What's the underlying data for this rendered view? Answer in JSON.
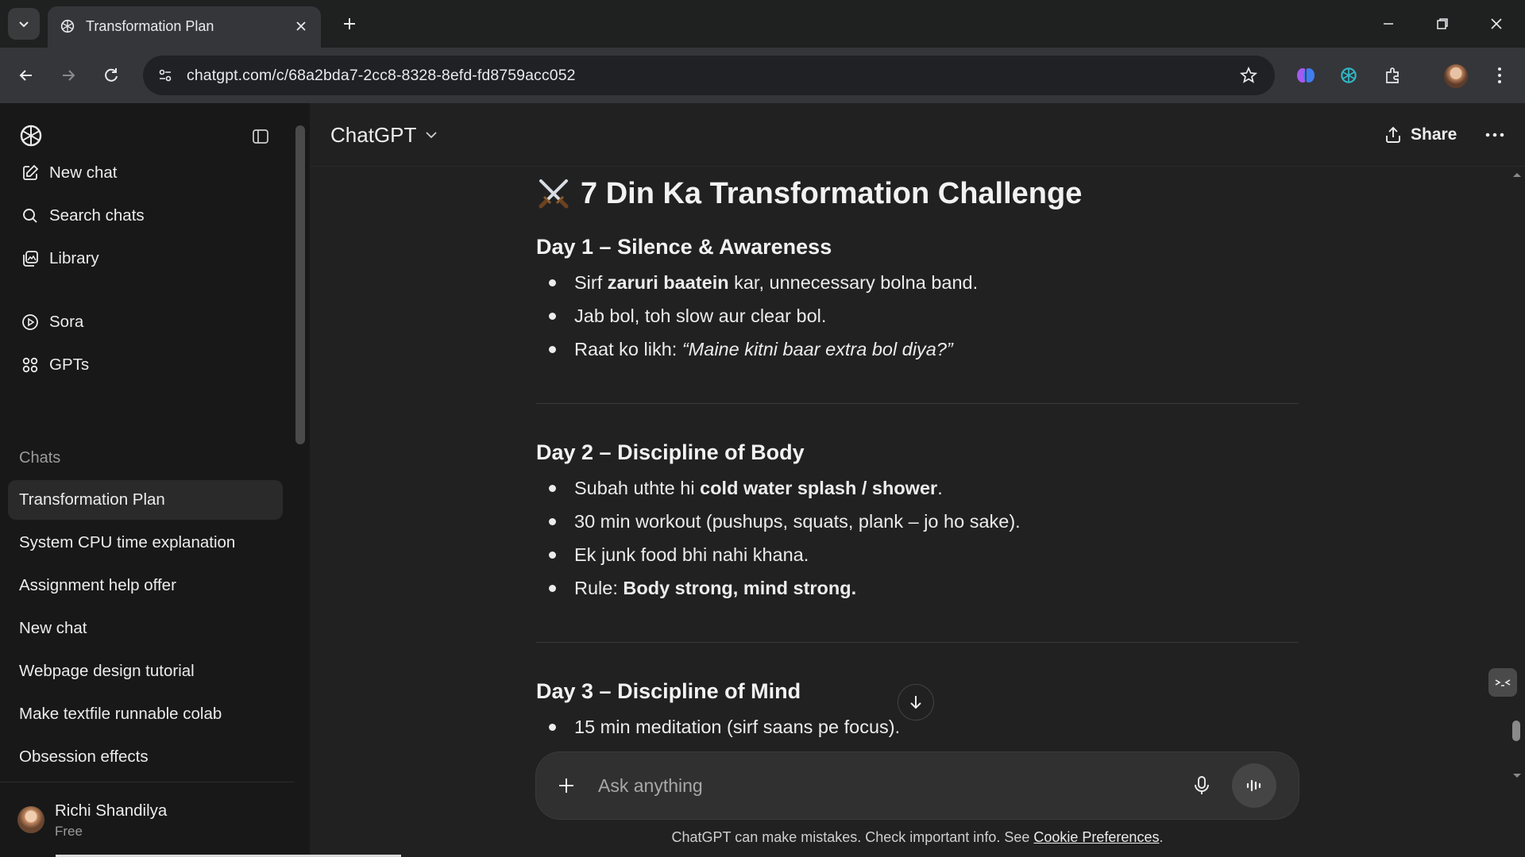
{
  "browser": {
    "tab_title": "Transformation Plan",
    "url": "chatgpt.com/c/68a2bda7-2cc8-8328-8efd-fd8759acc052",
    "icons": [
      "tab-list-icon",
      "openai-favicon",
      "close-icon",
      "plus-icon",
      "minimize-icon",
      "restore-icon",
      "close-window-icon",
      "back-icon",
      "forward-icon",
      "reload-icon",
      "site-info-icon",
      "star-icon",
      "extension-brain-icon",
      "extension-chatgpt-icon",
      "puzzle-icon",
      "more-vert-icon"
    ]
  },
  "sidebar": {
    "nav": [
      {
        "label": "New chat",
        "icon": "edit-icon"
      },
      {
        "label": "Search chats",
        "icon": "search-icon"
      },
      {
        "label": "Library",
        "icon": "library-icon"
      },
      {
        "label": "Sora",
        "icon": "play-icon"
      },
      {
        "label": "GPTs",
        "icon": "grid-icon"
      }
    ],
    "section_title": "Chats",
    "chats": [
      "Transformation Plan",
      "System CPU time explanation",
      "Assignment help offer",
      "New chat",
      "Webpage design tutorial",
      "Make textfile runnable colab",
      "Obsession effects"
    ],
    "active_chat": "Transformation Plan",
    "user": {
      "name": "Richi Shandilya",
      "plan": "Free"
    }
  },
  "header": {
    "model": "ChatGPT",
    "share_label": "Share"
  },
  "message": {
    "title": "7 Din Ka Transformation Challenge",
    "title_emoji": "crossed-swords-icon",
    "days": [
      {
        "heading": "Day 1 – Silence & Awareness",
        "items": [
          {
            "pre": "Sirf ",
            "bold": "zaruri baatein",
            "post": " kar, unnecessary bolna band."
          },
          {
            "pre": "Jab bol, toh slow aur clear bol.",
            "bold": "",
            "post": ""
          },
          {
            "pre": "Raat ko likh: ",
            "italic": "“Maine kitni baar extra bol diya?”",
            "post": ""
          }
        ]
      },
      {
        "heading": "Day 2 – Discipline of Body",
        "items": [
          {
            "pre": "Subah uthte hi ",
            "bold": "cold water splash / shower",
            "post": "."
          },
          {
            "pre": "30 min workout (pushups, squats, plank – jo ho sake).",
            "bold": "",
            "post": ""
          },
          {
            "pre": "Ek junk food bhi nahi khana.",
            "bold": "",
            "post": ""
          },
          {
            "pre": "Rule: ",
            "bold": "Body strong, mind strong.",
            "post": ""
          }
        ]
      },
      {
        "heading": "Day 3 – Discipline of Mind",
        "items": [
          {
            "pre": "15 min meditation (sirf saans pe focus).",
            "bold": "",
            "post": ""
          }
        ]
      }
    ]
  },
  "composer": {
    "placeholder": "Ask anything"
  },
  "footer": {
    "note": "ChatGPT can make mistakes. Check important info. See ",
    "link": "Cookie Preferences",
    "end": "."
  },
  "colors": {
    "background": "#212121",
    "sidebar": "#181818",
    "composer": "#303030",
    "text": "#ececec",
    "chrome_toolbar": "#35363a"
  }
}
